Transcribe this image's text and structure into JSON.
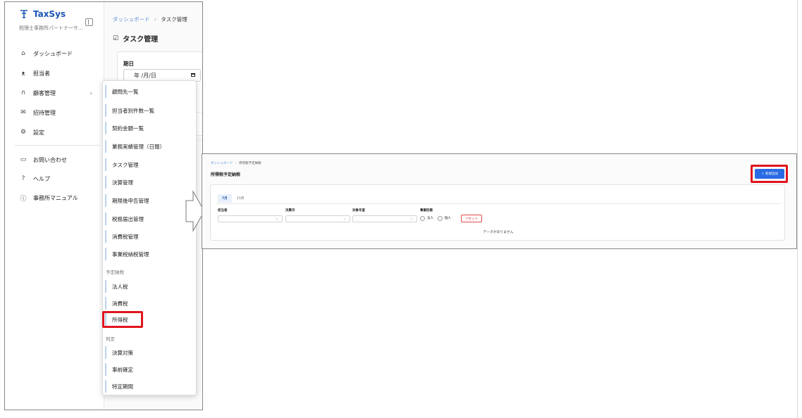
{
  "brand": {
    "name": "TaxSys",
    "subtitle": "税理士事務所パートナーサ…"
  },
  "sidebar": {
    "items": [
      {
        "label": "ダッシュボード",
        "icon": "home-icon"
      },
      {
        "label": "担当者",
        "icon": "user-icon"
      },
      {
        "label": "顧客管理",
        "icon": "headset-icon",
        "chevron": "›"
      },
      {
        "label": "招待管理",
        "icon": "mail-icon"
      },
      {
        "label": "設定",
        "icon": "gear-icon"
      },
      {
        "label": "お問い合わせ",
        "icon": "chat-icon"
      },
      {
        "label": "ヘルプ",
        "icon": "help-icon"
      },
      {
        "label": "事務所マニュアル",
        "icon": "info-icon"
      }
    ]
  },
  "main_left": {
    "breadcrumb": {
      "home": "ダッシュボード",
      "sep": "›",
      "current": "タスク管理"
    },
    "title": "タスク管理",
    "filter": {
      "label": "期日",
      "date_placeholder": "年 /月/日"
    }
  },
  "dropdown": {
    "items_main": [
      "顧問先一覧",
      "担当者別件数一覧",
      "契約金額一覧",
      "業務実績管理（日報）",
      "タスク管理",
      "決算管理",
      "期限後申告管理",
      "税務届出管理",
      "消費税管理",
      "事業税納税管理"
    ],
    "group_yotei": "予定納税",
    "items_yotei": [
      "法人税",
      "消費税",
      "所得税"
    ],
    "group_hantei": "判定",
    "items_hantei": [
      "決算対策",
      "事前確定",
      "特定期間"
    ]
  },
  "right_panel": {
    "breadcrumb": {
      "home": "ダッシュボード",
      "sep": "›",
      "current": "所得税予定納税"
    },
    "title": "所得税予定納税",
    "new_button": "＋ 新規追加",
    "tabs": [
      "7月",
      "11月"
    ],
    "filters": {
      "assignee": "担当者",
      "fiscal_month": "決算月",
      "target_year": "対象年度",
      "business_type": "事業形態"
    },
    "radio_options": [
      "法人",
      "個人"
    ],
    "reset_button": "リセット",
    "empty_message": "データがありません"
  },
  "colors": {
    "accent": "#2a6ae3",
    "highlight": "#e0141e",
    "brand": "#1a56b6"
  }
}
